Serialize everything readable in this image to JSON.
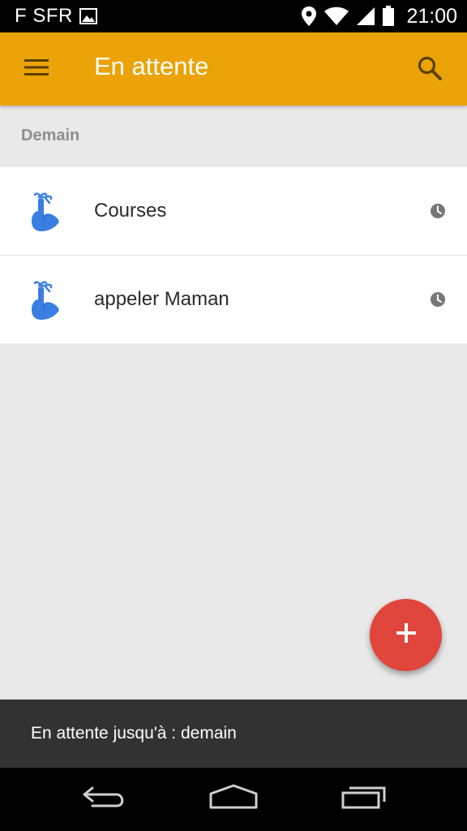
{
  "status_bar": {
    "carrier": "F SFR",
    "time": "21:00",
    "icons": [
      "image-icon",
      "location-pin-icon",
      "wifi-icon",
      "signal-icon",
      "battery-icon"
    ]
  },
  "app_bar": {
    "title": "En attente",
    "menu_icon": "hamburger-menu-icon",
    "search_icon": "search-icon",
    "color": "#eba307"
  },
  "section": {
    "header": "Demain"
  },
  "items": [
    {
      "label": "Courses",
      "icon": "finger-ribbon-reminder-icon",
      "status_icon": "clock-icon"
    },
    {
      "label": "appeler Maman",
      "icon": "finger-ribbon-reminder-icon",
      "status_icon": "clock-icon"
    }
  ],
  "fab": {
    "icon": "plus-icon",
    "color": "#e0453b"
  },
  "snackbar": {
    "text": "En attente jusqu'à : demain"
  },
  "nav_bar": {
    "icons": [
      "back-icon",
      "home-icon",
      "recent-apps-icon"
    ]
  }
}
